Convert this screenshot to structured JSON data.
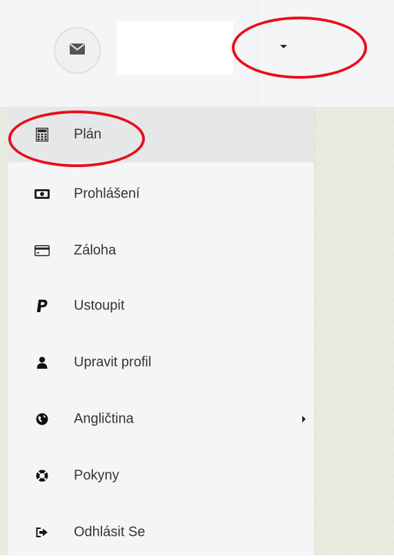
{
  "header": {
    "mail_icon": "envelope-icon",
    "dropdown_icon": "caret-down-icon"
  },
  "menu": {
    "items": [
      {
        "label": "Plán",
        "icon": "calculator-icon",
        "active": true
      },
      {
        "label": "Prohlášení",
        "icon": "money-bill-icon",
        "active": false
      },
      {
        "label": "Záloha",
        "icon": "credit-card-icon",
        "active": false
      },
      {
        "label": "Ustoupit",
        "icon": "paypal-icon",
        "active": false
      },
      {
        "label": "Upravit profil",
        "icon": "user-icon",
        "active": false
      },
      {
        "label": "Angličtina",
        "icon": "globe-icon",
        "active": false,
        "has_submenu": true
      },
      {
        "label": "Pokyny",
        "icon": "life-ring-icon",
        "active": false
      },
      {
        "label": "Odhlásit Se",
        "icon": "sign-out-icon",
        "active": false
      }
    ]
  },
  "colors": {
    "annotation": "#e8101a",
    "active_item_bg": "#e6e7e9",
    "menu_bg": "#f4f5f6",
    "header_bg": "#f3f5f7"
  }
}
